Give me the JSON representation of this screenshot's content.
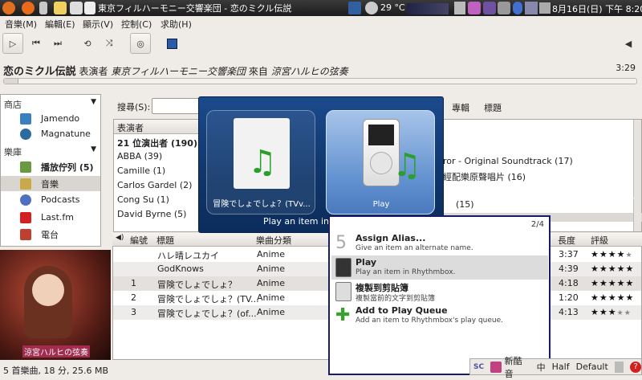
{
  "window_title": "東京フィルハーモニー交響楽団 - 恋のミクル伝説",
  "panel": {
    "weather": "29 °C",
    "date_time": "8月16日(日) 下午 8:20"
  },
  "menu": [
    "音樂(M)",
    "編輯(E)",
    "顯示(V)",
    "控制(C)",
    "求助(H)"
  ],
  "now_playing": {
    "title": "恋のミクル伝説",
    "by_label": "表演者",
    "artist": "東京フィルハーモニー交響楽団",
    "from_label": "來自",
    "album": "涼宮ハルヒの弦奏",
    "time": "3:29"
  },
  "sources": {
    "store_header": "商店",
    "store_items": [
      "Jamendo",
      "Magnatune"
    ],
    "library_header": "樂庫",
    "library_items": [
      "播放佇列 (5)",
      "音樂",
      "Podcasts",
      "Last.fm",
      "電台"
    ]
  },
  "browser": {
    "search_label": "搜尋(S):",
    "categories": [
      "專輯",
      "標題"
    ],
    "artist_header": "表演者",
    "artists": [
      "21 位演出者 (190)",
      "ABBA (39)",
      "Camille (1)",
      "Carlos Gardel (2)",
      "Cong Su (1)",
      "David Byrne (5)"
    ],
    "albums": [
      "ror - Original Soundtrack (17)",
      "經配樂原聲唱片 (16)",
      "(15)"
    ]
  },
  "overlay": {
    "card1_label": "冒険でしょでしょ？(TVv...",
    "card2_label": "Play",
    "bottom_text": "Play an item in"
  },
  "popup": {
    "counter": "2/4",
    "items": [
      {
        "title": "Assign Alias...",
        "desc": "Give an item an alternate name."
      },
      {
        "title": "Play",
        "desc": "Play an item in Rhythmbox."
      },
      {
        "title": "複製到剪貼簿",
        "desc": "複製當前的文字到剪貼簿"
      },
      {
        "title": "Add to Play Queue",
        "desc": "Add an item to Rhythmbox's play queue."
      }
    ]
  },
  "tracks": {
    "headers": {
      "num": "編號",
      "title": "標題",
      "genre": "樂曲分類",
      "time": "長度",
      "rating": "評級"
    },
    "rows": [
      {
        "num": "",
        "title": "ハレ晴レユカイ",
        "genre": "Anime",
        "time": "3:37",
        "rating": 4
      },
      {
        "num": "",
        "title": "GodKnows",
        "genre": "Anime",
        "time": "4:39",
        "rating": 5
      },
      {
        "num": "1",
        "title": "冒険でしょでしょ？",
        "genre": "Anime",
        "time": "4:18",
        "rating": 5
      },
      {
        "num": "2",
        "title": "冒険でしょでしょ？(TV...",
        "genre": "Anime",
        "time": "1:20",
        "rating": 5
      },
      {
        "num": "3",
        "title": "冒険でしょでしょ？(of...",
        "genre": "Anime",
        "time": "4:13",
        "rating": 3
      }
    ]
  },
  "album_art_caption": "涼宮ハルヒの弦奏",
  "status": "5 首樂曲, 18 分, 25.6 MB",
  "ime": {
    "name": "新酷音",
    "mode": "中",
    "width": "Half",
    "layout": "Default"
  }
}
